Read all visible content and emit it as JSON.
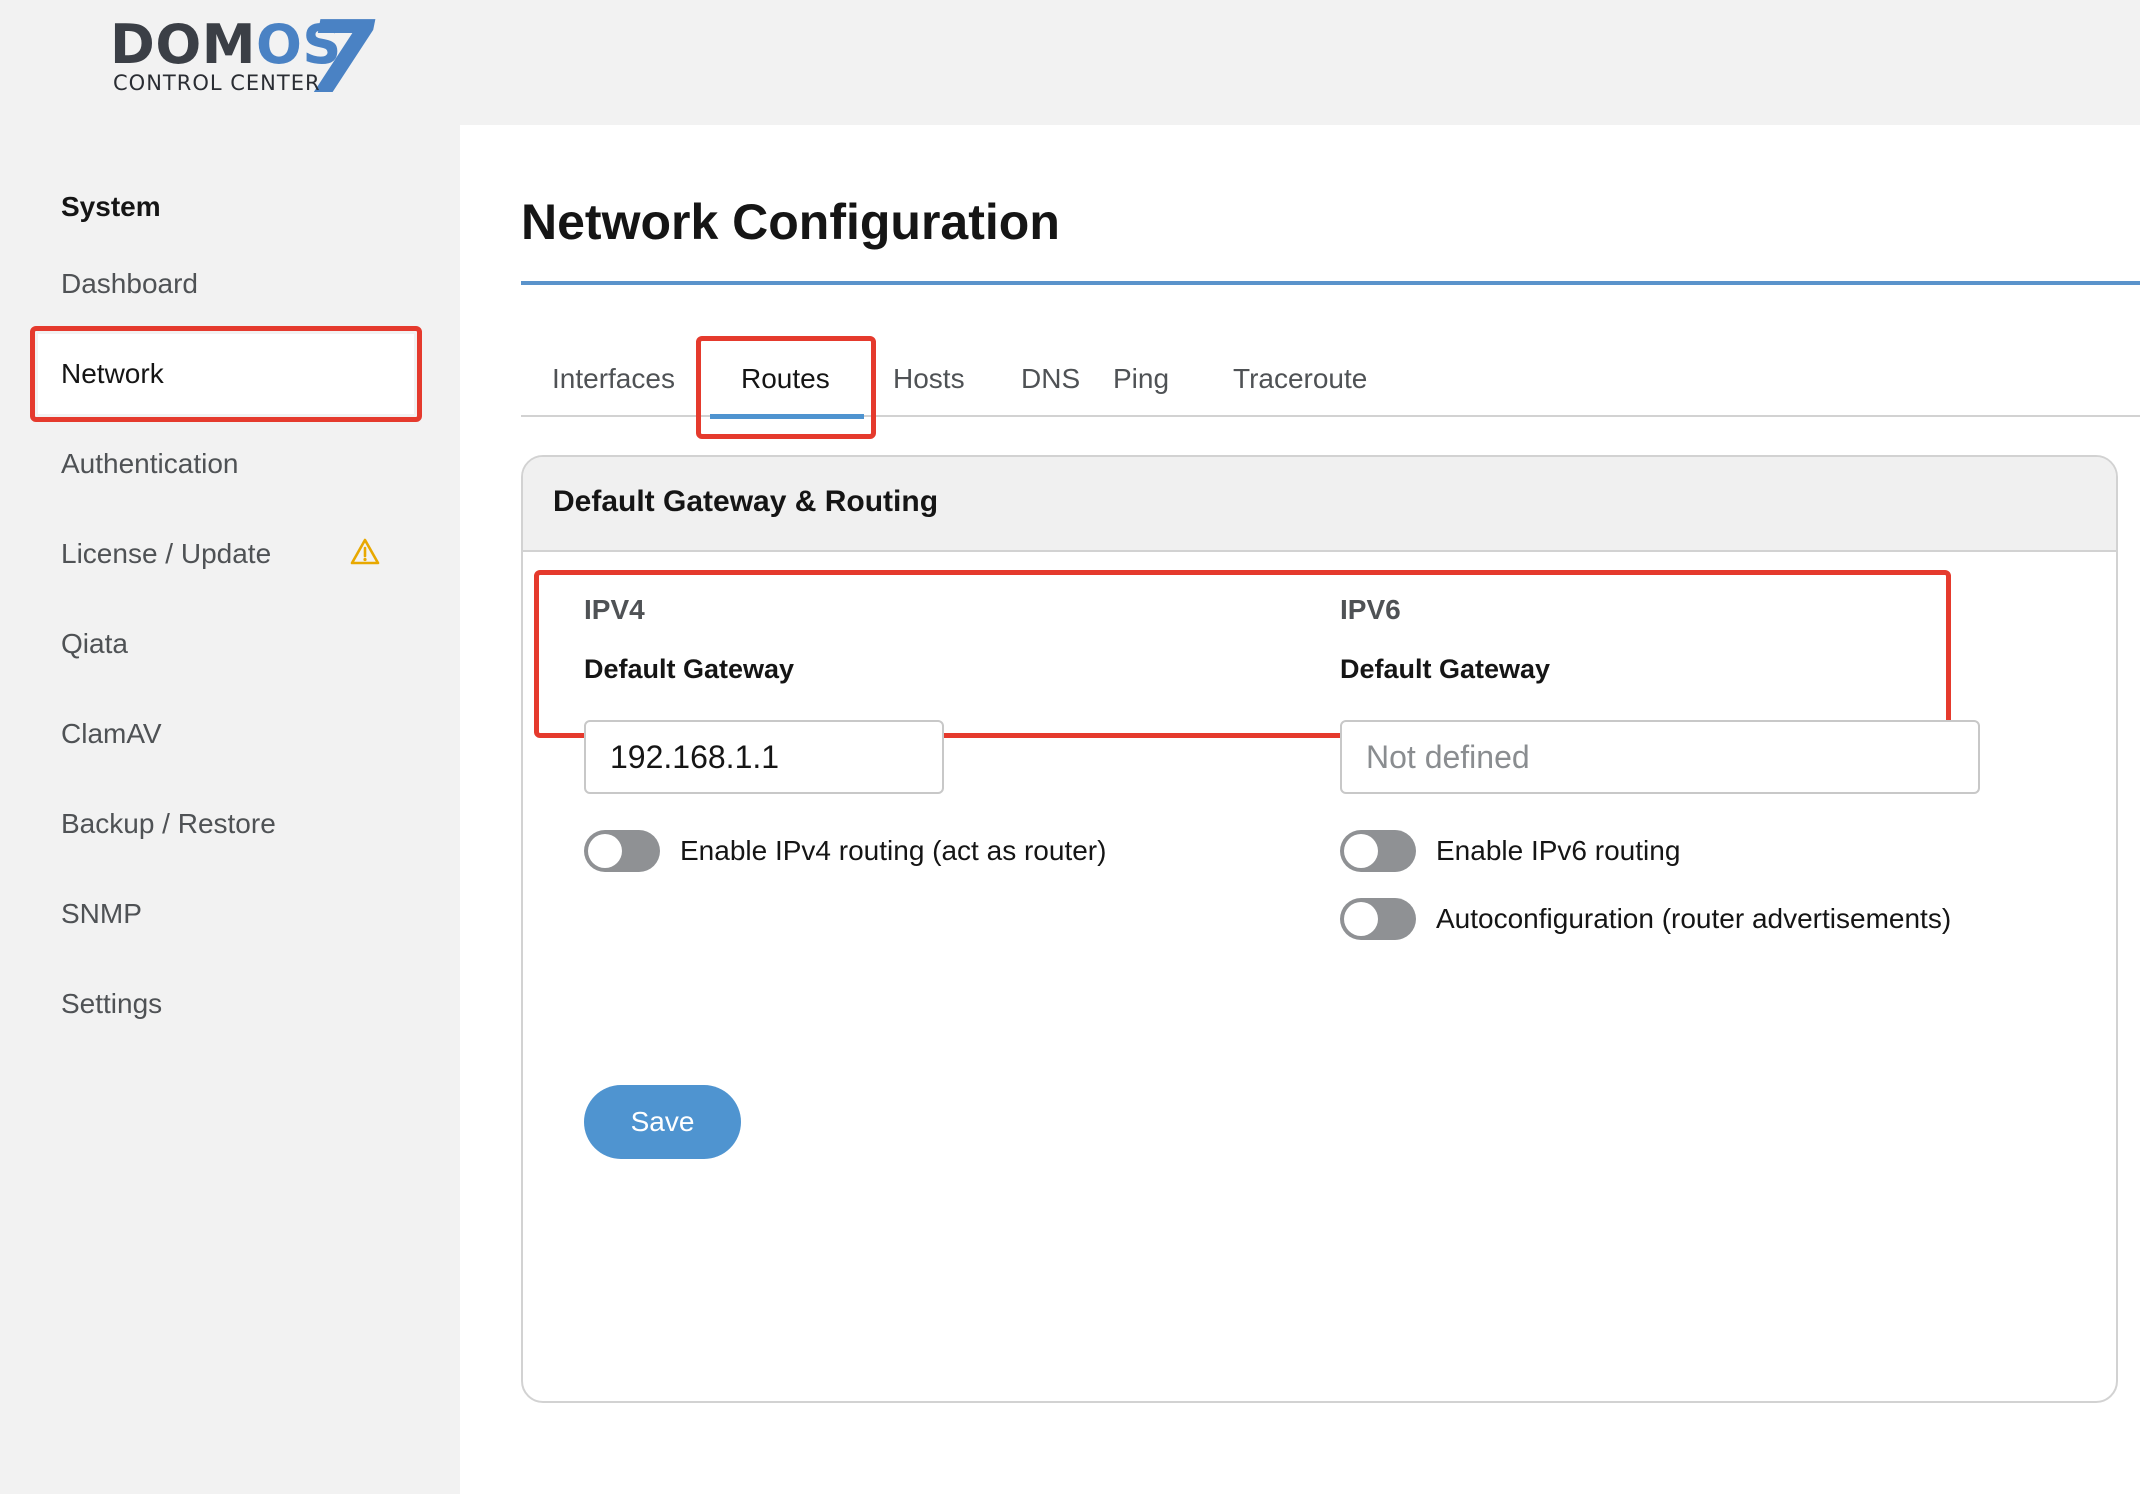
{
  "logo": {
    "word_dark": "DOM",
    "word_blue": "OS",
    "number": "7",
    "subtitle": "CONTROL CENTER"
  },
  "sidebar": {
    "heading": "System",
    "items": [
      {
        "label": "Dashboard"
      },
      {
        "label": "Network",
        "active": true
      },
      {
        "label": "Authentication"
      },
      {
        "label": "License / Update",
        "icon": "warning-icon"
      },
      {
        "label": "Qiata"
      },
      {
        "label": "ClamAV"
      },
      {
        "label": "Backup / Restore"
      },
      {
        "label": "SNMP"
      },
      {
        "label": "Settings"
      }
    ]
  },
  "main": {
    "title": "Network Configuration",
    "tabs": [
      {
        "label": "Interfaces"
      },
      {
        "label": "Routes",
        "active": true
      },
      {
        "label": "Hosts"
      },
      {
        "label": "DNS"
      },
      {
        "label": "Ping"
      },
      {
        "label": "Traceroute"
      }
    ],
    "card": {
      "title": "Default Gateway & Routing",
      "ipv4": {
        "heading": "IPV4",
        "gateway_label": "Default Gateway",
        "gateway_value": "192.168.1.1",
        "routing_toggle_label": "Enable IPv4 routing (act as router)",
        "routing_enabled": false
      },
      "ipv6": {
        "heading": "IPV6",
        "gateway_label": "Default Gateway",
        "gateway_value": "",
        "gateway_placeholder": "Not defined",
        "routing_toggle_label": "Enable IPv6 routing",
        "routing_enabled": false,
        "autoconf_toggle_label": "Autoconfiguration (router advertisements)",
        "autoconf_enabled": false
      },
      "save_label": "Save"
    }
  },
  "colors": {
    "accent": "#4f94d0",
    "highlight": "#e53a2d",
    "warning": "#e8a800",
    "logo_blue": "#4a82c4"
  }
}
